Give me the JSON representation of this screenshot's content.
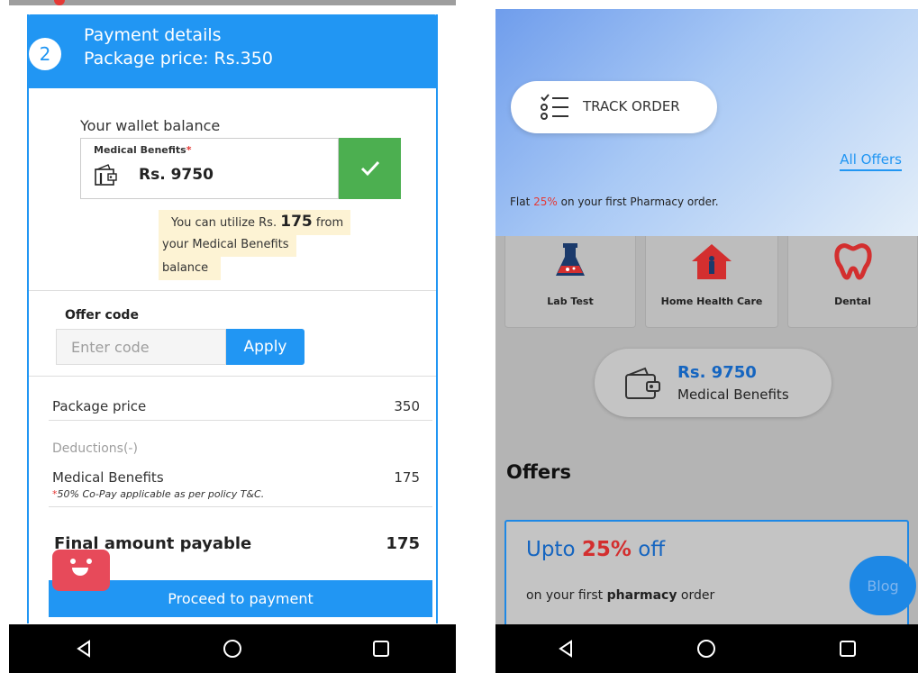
{
  "left": {
    "step_number": "2",
    "header": {
      "title": "Payment details",
      "price_line": "Package price:  Rs.350"
    },
    "wallet": {
      "label": "Your wallet balance",
      "benefit_label": "Medical Benefits",
      "required_mark": "*",
      "amount": "Rs. 9750"
    },
    "utilize": {
      "pre": "You can utilize Rs. ",
      "amount": "175",
      "post": " from",
      "line2": "your Medical Benefits",
      "line3": "balance"
    },
    "offer": {
      "label": "Offer code",
      "placeholder": "Enter code",
      "apply": "Apply"
    },
    "summary": {
      "package_label": "Package price",
      "package_value": "350",
      "deductions_label": "Deductions(-)",
      "benefit_label": "Medical Benefits",
      "benefit_value": "175",
      "copay_mark": "*",
      "copay_note": "50% Co-Pay applicable as per policy T&C.",
      "final_label": "Final amount payable",
      "final_value": "175"
    },
    "proceed": "Proceed to payment"
  },
  "right": {
    "track_order": "TRACK ORDER",
    "all_offers": "All Offers",
    "flat": {
      "pre": "Flat ",
      "pct": "25%",
      "post": " on your first Pharmacy order."
    },
    "services": [
      {
        "label": "Lab Test"
      },
      {
        "label": "Home Health Care"
      },
      {
        "label": "Dental"
      }
    ],
    "wallet": {
      "amount": "Rs. 9750",
      "label": "Medical Benefits"
    },
    "offers_heading": "Offers",
    "offer_card": {
      "pre": "Upto ",
      "pct": "25%",
      "post": " off",
      "sub_pre": "on your first ",
      "sub_bold": "pharmacy",
      "sub_post": " order"
    },
    "blog": "Blog"
  },
  "colors": {
    "primary": "#2196f3",
    "success": "#4caf50",
    "accent_red": "#e53935",
    "highlight": "#fdf3d4"
  }
}
